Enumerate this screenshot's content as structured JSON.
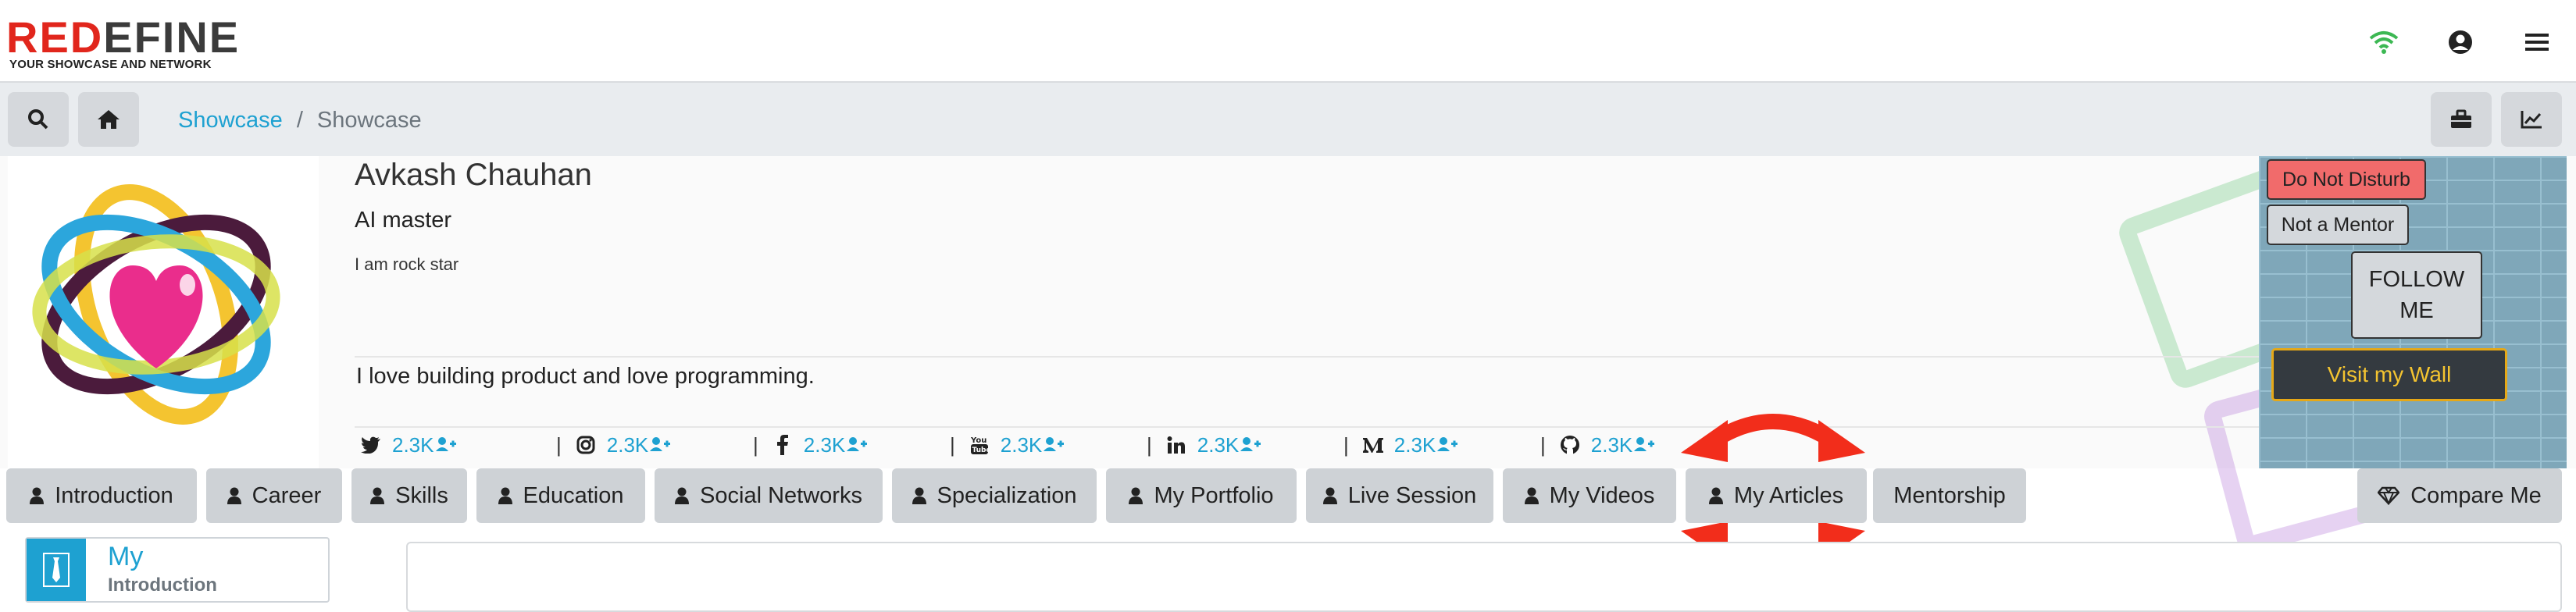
{
  "brand": {
    "logo_red": "RED",
    "logo_dark": "EFINE",
    "logo_red2": "",
    "tagline": "YOUR SHOWCASE AND NETWORK",
    "accent": "#1ea1d1",
    "logo_red_color": "#e1261c"
  },
  "topbar": {
    "icons": [
      "wifi-icon",
      "user-circle-icon",
      "menu-icon"
    ]
  },
  "breadcrumb": {
    "home_link": "Showcase",
    "separator": "/",
    "current": "Showcase"
  },
  "profile": {
    "name": "Avkash Chauhan",
    "title": "AI master",
    "tagline": "I am rock star",
    "bio": "I love building product and love programming."
  },
  "socials": [
    {
      "icon": "twitter-icon",
      "count": "2.3K"
    },
    {
      "icon": "instagram-icon",
      "count": "2.3K"
    },
    {
      "icon": "facebook-icon",
      "count": "2.3K"
    },
    {
      "icon": "youtube-icon",
      "count": "2.3K"
    },
    {
      "icon": "linkedin-icon",
      "count": "2.3K"
    },
    {
      "icon": "medium-icon",
      "count": "2.3K"
    },
    {
      "icon": "github-icon",
      "count": "2.3K"
    }
  ],
  "wall": {
    "do_not_disturb": "Do Not Disturb",
    "not_mentor": "Not a Mentor",
    "follow": "FOLLOW ME",
    "visit_wall": "Visit my Wall"
  },
  "tabs": [
    {
      "label": "Introduction",
      "icon": "user-icon"
    },
    {
      "label": "Career",
      "icon": "user-icon"
    },
    {
      "label": "Skills",
      "icon": "user-icon"
    },
    {
      "label": "Education",
      "icon": "user-icon"
    },
    {
      "label": "Social Networks",
      "icon": "user-icon"
    },
    {
      "label": "Specialization",
      "icon": "user-icon"
    },
    {
      "label": "My Portfolio",
      "icon": "user-icon"
    },
    {
      "label": "Live Session",
      "icon": "user-icon"
    },
    {
      "label": "My Videos",
      "icon": "user-icon"
    },
    {
      "label": "My Articles",
      "icon": "user-icon"
    },
    {
      "label": "Mentorship",
      "icon": ""
    }
  ],
  "compare": {
    "label": "Compare Me",
    "icon": "diamond-icon"
  },
  "side": {
    "my": "My",
    "sub": "Introduction",
    "icon": "tie-icon"
  }
}
